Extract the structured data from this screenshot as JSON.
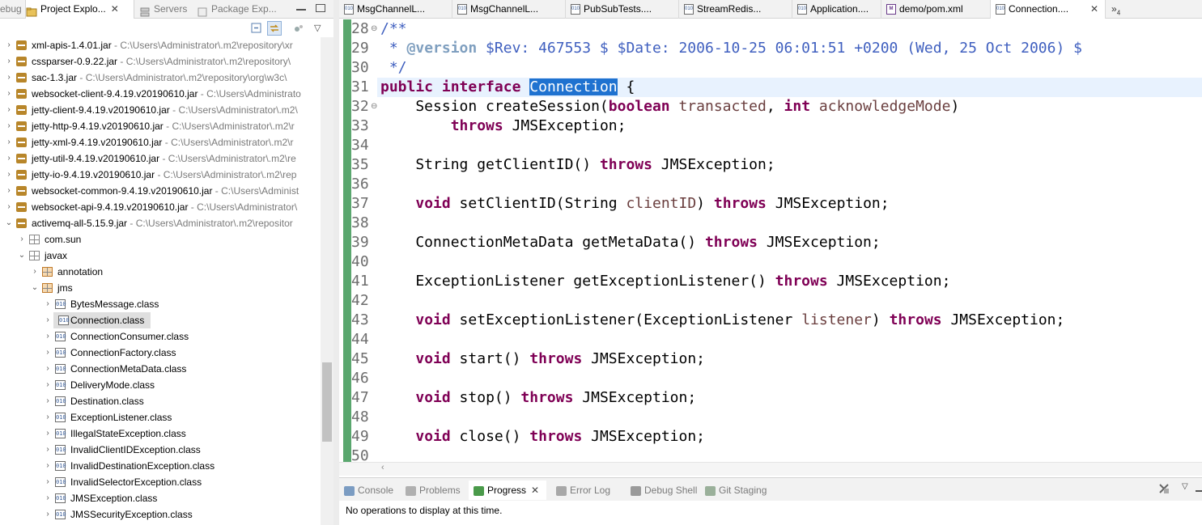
{
  "left_view": {
    "tabs": [
      {
        "label": "ebug",
        "active": false
      },
      {
        "label": "Project Explo...",
        "active": true
      },
      {
        "label": "Servers",
        "active": false
      },
      {
        "label": "Package Exp...",
        "active": false
      }
    ],
    "tree": [
      {
        "name": "xml-apis-1.4.01.jar",
        "path": " - C:\\Users\\Administrator\\.m2\\repository\\xr",
        "indent": 0,
        "twisty": "›",
        "icon": "jar"
      },
      {
        "name": "cssparser-0.9.22.jar",
        "path": " - C:\\Users\\Administrator\\.m2\\repository\\",
        "indent": 0,
        "twisty": "›",
        "icon": "jar"
      },
      {
        "name": "sac-1.3.jar",
        "path": " - C:\\Users\\Administrator\\.m2\\repository\\org\\w3c\\",
        "indent": 0,
        "twisty": "›",
        "icon": "jar"
      },
      {
        "name": "websocket-client-9.4.19.v20190610.jar",
        "path": " - C:\\Users\\Administrato",
        "indent": 0,
        "twisty": "›",
        "icon": "jar"
      },
      {
        "name": "jetty-client-9.4.19.v20190610.jar",
        "path": " - C:\\Users\\Administrator\\.m2\\",
        "indent": 0,
        "twisty": "›",
        "icon": "jar"
      },
      {
        "name": "jetty-http-9.4.19.v20190610.jar",
        "path": " - C:\\Users\\Administrator\\.m2\\r",
        "indent": 0,
        "twisty": "›",
        "icon": "jar"
      },
      {
        "name": "jetty-xml-9.4.19.v20190610.jar",
        "path": " - C:\\Users\\Administrator\\.m2\\r",
        "indent": 0,
        "twisty": "›",
        "icon": "jar"
      },
      {
        "name": "jetty-util-9.4.19.v20190610.jar",
        "path": " - C:\\Users\\Administrator\\.m2\\re",
        "indent": 0,
        "twisty": "›",
        "icon": "jar"
      },
      {
        "name": "jetty-io-9.4.19.v20190610.jar",
        "path": " - C:\\Users\\Administrator\\.m2\\rep",
        "indent": 0,
        "twisty": "›",
        "icon": "jar"
      },
      {
        "name": "websocket-common-9.4.19.v20190610.jar",
        "path": " - C:\\Users\\Administ",
        "indent": 0,
        "twisty": "›",
        "icon": "jar"
      },
      {
        "name": "websocket-api-9.4.19.v20190610.jar",
        "path": " - C:\\Users\\Administrator\\",
        "indent": 0,
        "twisty": "›",
        "icon": "jar"
      },
      {
        "name": "activemq-all-5.15.9.jar",
        "path": " - C:\\Users\\Administrator\\.m2\\repositor",
        "indent": 0,
        "twisty": "⌄",
        "icon": "jar"
      },
      {
        "name": "com.sun",
        "path": "",
        "indent": 1,
        "twisty": "›",
        "icon": "pkg"
      },
      {
        "name": "javax",
        "path": "",
        "indent": 1,
        "twisty": "⌄",
        "icon": "pkg"
      },
      {
        "name": "annotation",
        "path": "",
        "indent": 2,
        "twisty": "›",
        "icon": "pkg-o"
      },
      {
        "name": "jms",
        "path": "",
        "indent": 2,
        "twisty": "⌄",
        "icon": "pkg-o"
      },
      {
        "name": "BytesMessage.class",
        "path": "",
        "indent": 3,
        "twisty": "›",
        "icon": "cls"
      },
      {
        "name": "Connection.class",
        "path": "",
        "indent": 3,
        "twisty": "›",
        "icon": "cls",
        "selected": true
      },
      {
        "name": "ConnectionConsumer.class",
        "path": "",
        "indent": 3,
        "twisty": "›",
        "icon": "cls"
      },
      {
        "name": "ConnectionFactory.class",
        "path": "",
        "indent": 3,
        "twisty": "›",
        "icon": "cls"
      },
      {
        "name": "ConnectionMetaData.class",
        "path": "",
        "indent": 3,
        "twisty": "›",
        "icon": "cls"
      },
      {
        "name": "DeliveryMode.class",
        "path": "",
        "indent": 3,
        "twisty": "›",
        "icon": "cls"
      },
      {
        "name": "Destination.class",
        "path": "",
        "indent": 3,
        "twisty": "›",
        "icon": "cls"
      },
      {
        "name": "ExceptionListener.class",
        "path": "",
        "indent": 3,
        "twisty": "›",
        "icon": "cls"
      },
      {
        "name": "IllegalStateException.class",
        "path": "",
        "indent": 3,
        "twisty": "›",
        "icon": "cls"
      },
      {
        "name": "InvalidClientIDException.class",
        "path": "",
        "indent": 3,
        "twisty": "›",
        "icon": "cls"
      },
      {
        "name": "InvalidDestinationException.class",
        "path": "",
        "indent": 3,
        "twisty": "›",
        "icon": "cls"
      },
      {
        "name": "InvalidSelectorException.class",
        "path": "",
        "indent": 3,
        "twisty": "›",
        "icon": "cls"
      },
      {
        "name": "JMSException.class",
        "path": "",
        "indent": 3,
        "twisty": "›",
        "icon": "cls"
      },
      {
        "name": "JMSSecurityException.class",
        "path": "",
        "indent": 3,
        "twisty": "›",
        "icon": "cls"
      }
    ]
  },
  "editor": {
    "tabs": [
      {
        "label": "MsgChannelL...",
        "icon": "java",
        "active": false
      },
      {
        "label": "MsgChannelL...",
        "icon": "java",
        "active": false
      },
      {
        "label": "PubSubTests....",
        "icon": "java",
        "active": false
      },
      {
        "label": "StreamRedis...",
        "icon": "java",
        "active": false
      },
      {
        "label": "Application....",
        "icon": "java",
        "active": false
      },
      {
        "label": "demo/pom.xml",
        "icon": "maven",
        "active": false
      },
      {
        "label": "Connection....",
        "icon": "class",
        "active": true
      }
    ],
    "overflow_label": "»",
    "overflow_count": "4",
    "lines": [
      {
        "n": "28",
        "fold": "⊖",
        "segs": [
          [
            "cm",
            "/**"
          ]
        ]
      },
      {
        "n": "29",
        "fold": "",
        "segs": [
          [
            "cm",
            " * "
          ],
          [
            "cmtag",
            "@version"
          ],
          [
            "cm",
            " $Rev: 467553 $ $Date: 2006-10-25 06:01:51 +0200 (Wed, 25 Oct 2006) $"
          ]
        ]
      },
      {
        "n": "30",
        "fold": "",
        "segs": [
          [
            "cm",
            " */"
          ]
        ]
      },
      {
        "n": "31",
        "fold": "",
        "segs": [
          [
            "kw",
            "public"
          ],
          [
            "",
            " "
          ],
          [
            "kw",
            "interface"
          ],
          [
            "",
            " "
          ],
          [
            "hl",
            "Connection"
          ],
          [
            "",
            " {"
          ]
        ]
      },
      {
        "n": "32",
        "fold": "⊖",
        "segs": [
          [
            "",
            "    Session createSession("
          ],
          [
            "kw",
            "boolean"
          ],
          [
            "",
            " "
          ],
          [
            "pr",
            "transacted"
          ],
          [
            "",
            ", "
          ],
          [
            "kw",
            "int"
          ],
          [
            "",
            " "
          ],
          [
            "pr",
            "acknowledgeMode"
          ],
          [
            "",
            ")"
          ]
        ]
      },
      {
        "n": "33",
        "fold": "",
        "segs": [
          [
            "",
            "        "
          ],
          [
            "kw",
            "throws"
          ],
          [
            "",
            " JMSException;"
          ]
        ]
      },
      {
        "n": "34",
        "fold": "",
        "segs": []
      },
      {
        "n": "35",
        "fold": "",
        "segs": [
          [
            "",
            "    String getClientID() "
          ],
          [
            "kw",
            "throws"
          ],
          [
            "",
            " JMSException;"
          ]
        ]
      },
      {
        "n": "36",
        "fold": "",
        "segs": []
      },
      {
        "n": "37",
        "fold": "",
        "segs": [
          [
            "",
            "    "
          ],
          [
            "kw",
            "void"
          ],
          [
            "",
            " setClientID(String "
          ],
          [
            "pr",
            "clientID"
          ],
          [
            "",
            ") "
          ],
          [
            "kw",
            "throws"
          ],
          [
            "",
            " JMSException;"
          ]
        ]
      },
      {
        "n": "38",
        "fold": "",
        "segs": []
      },
      {
        "n": "39",
        "fold": "",
        "segs": [
          [
            "",
            "    ConnectionMetaData getMetaData() "
          ],
          [
            "kw",
            "throws"
          ],
          [
            "",
            " JMSException;"
          ]
        ]
      },
      {
        "n": "40",
        "fold": "",
        "segs": []
      },
      {
        "n": "41",
        "fold": "",
        "segs": [
          [
            "",
            "    ExceptionListener getExceptionListener() "
          ],
          [
            "kw",
            "throws"
          ],
          [
            "",
            " JMSException;"
          ]
        ]
      },
      {
        "n": "42",
        "fold": "",
        "segs": []
      },
      {
        "n": "43",
        "fold": "",
        "segs": [
          [
            "",
            "    "
          ],
          [
            "kw",
            "void"
          ],
          [
            "",
            " setExceptionListener(ExceptionListener "
          ],
          [
            "pr",
            "listener"
          ],
          [
            "",
            ") "
          ],
          [
            "kw",
            "throws"
          ],
          [
            "",
            " JMSException;"
          ]
        ]
      },
      {
        "n": "44",
        "fold": "",
        "segs": []
      },
      {
        "n": "45",
        "fold": "",
        "segs": [
          [
            "",
            "    "
          ],
          [
            "kw",
            "void"
          ],
          [
            "",
            " start() "
          ],
          [
            "kw",
            "throws"
          ],
          [
            "",
            " JMSException;"
          ]
        ]
      },
      {
        "n": "46",
        "fold": "",
        "segs": []
      },
      {
        "n": "47",
        "fold": "",
        "segs": [
          [
            "",
            "    "
          ],
          [
            "kw",
            "void"
          ],
          [
            "",
            " stop() "
          ],
          [
            "kw",
            "throws"
          ],
          [
            "",
            " JMSException;"
          ]
        ]
      },
      {
        "n": "48",
        "fold": "",
        "segs": []
      },
      {
        "n": "49",
        "fold": "",
        "segs": [
          [
            "",
            "    "
          ],
          [
            "kw",
            "void"
          ],
          [
            "",
            " close() "
          ],
          [
            "kw",
            "throws"
          ],
          [
            "",
            " JMSException;"
          ]
        ]
      },
      {
        "n": "50",
        "fold": "",
        "segs": []
      }
    ]
  },
  "bottom_panel": {
    "tabs": [
      {
        "label": "Console",
        "active": false
      },
      {
        "label": "Problems",
        "active": false
      },
      {
        "label": "Progress",
        "active": true
      },
      {
        "label": "Error Log",
        "active": false
      },
      {
        "label": "Debug Shell",
        "active": false
      },
      {
        "label": "Git Staging",
        "active": false
      }
    ],
    "message": "No operations to display at this time."
  },
  "colors": {
    "keyword": "#7f0055",
    "comment": "#3f5fbf",
    "selection": "#1f72d0",
    "current_line": "#e8f2fe"
  }
}
